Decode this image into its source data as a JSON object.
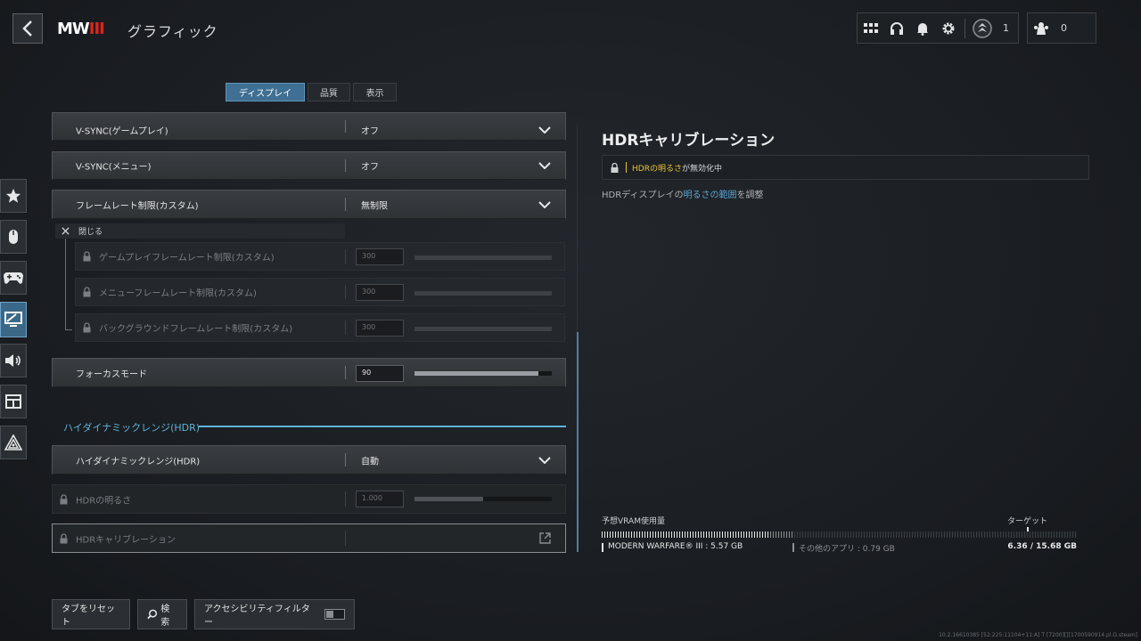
{
  "header": {
    "logo": "MW",
    "logo_suffix": "III",
    "page_title": "グラフィック",
    "rank_count": "1",
    "party_count": "0"
  },
  "tabs": [
    {
      "label": "ディスプレイ",
      "active": true
    },
    {
      "label": "品質",
      "active": false
    },
    {
      "label": "表示",
      "active": false
    }
  ],
  "settings": {
    "vsync_game": {
      "label": "V-SYNC(ゲームプレイ)",
      "value": "オフ"
    },
    "vsync_menu": {
      "label": "V-SYNC(メニュー)",
      "value": "オフ"
    },
    "framerate_limit": {
      "label": "フレームレート制限(カスタム)",
      "value": "無制限"
    },
    "close_label": "閉じる",
    "sub_gameplay": {
      "label": "ゲームプレイフレームレート制限(カスタム)",
      "value": "300"
    },
    "sub_menu": {
      "label": "メニューフレームレート制限(カスタム)",
      "value": "300"
    },
    "sub_background": {
      "label": "バックグラウンドフレームレート制限(カスタム)",
      "value": "300"
    },
    "focus_mode": {
      "label": "フォーカスモード",
      "value": "90",
      "level": 0.9
    },
    "section_hdr": "ハイダイナミックレンジ(HDR)",
    "hdr_mode": {
      "label": "ハイダイナミックレンジ(HDR)",
      "value": "自動"
    },
    "hdr_brightness": {
      "label": "HDRの明るさ",
      "value": "1.000",
      "level": 0.5
    },
    "hdr_calibration": {
      "label": "HDRキャリブレーション"
    }
  },
  "detail": {
    "title": "HDRキャリブレーション",
    "notice_highlight": "HDRの明るさ",
    "notice_rest": "が無効化中",
    "desc_prefix": "HDRディスプレイの",
    "desc_link": "明るさの範囲",
    "desc_suffix": "を調整"
  },
  "vram": {
    "label": "予想VRAM使用量",
    "target_label": "ターゲット",
    "game_usage": "MODERN WARFARE® III : 5.57 GB",
    "other_usage": "その他のアプリ : 0.79 GB",
    "total": "6.36 / 15.68 GB",
    "game_gb": 5.57,
    "other_gb": 0.79,
    "total_gb": 15.68
  },
  "footer": {
    "reset_tab": "タブをリセット",
    "search": "検索",
    "accessibility_filter": "アクセシビリティフィルター",
    "build_info": "10.2.16610385 [52:225:11104+11:A] T [7200][][1700590914.pl.G.steam]"
  },
  "colors": {
    "accent": "#3f6f92",
    "hdr_section": "#5fb3d9",
    "highlight": "#e8c63a",
    "link": "#5aa5d6"
  }
}
